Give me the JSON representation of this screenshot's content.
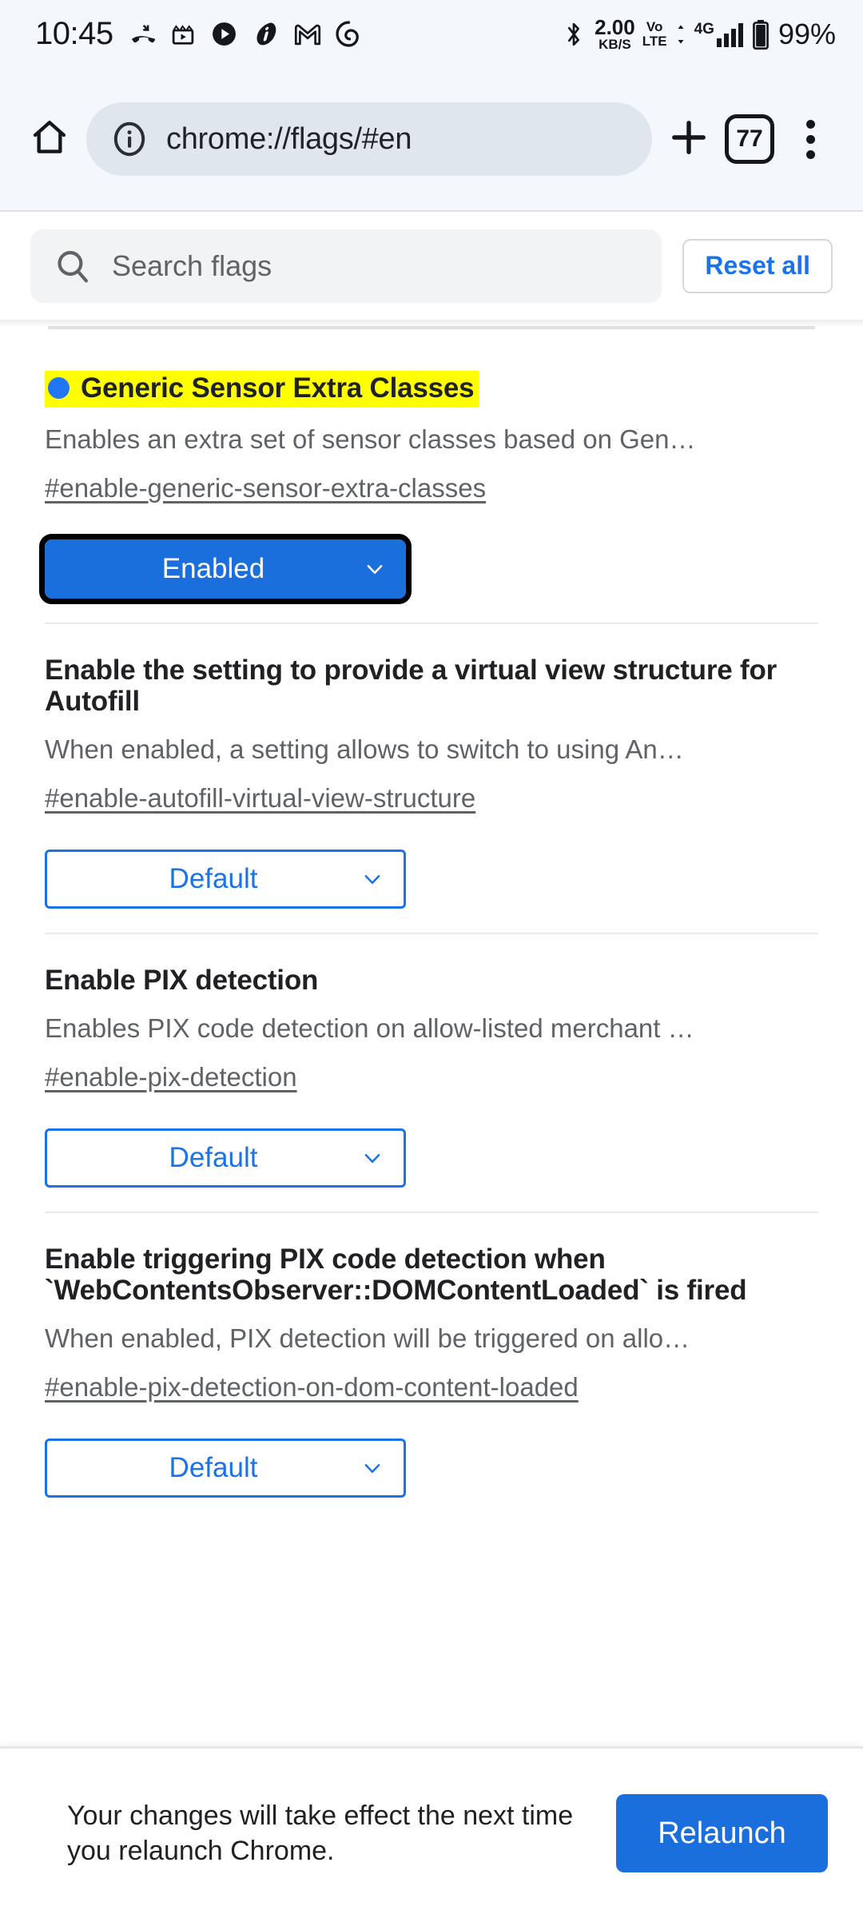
{
  "status_bar": {
    "time": "10:45",
    "left_icons": [
      "missed-call-icon",
      "clapperboard-icon",
      "play-circle-icon",
      "app-italic-i-icon",
      "gmail-icon",
      "spiral-app-icon"
    ],
    "bluetooth_icon": "bluetooth-icon",
    "network_speed_value": "2.00",
    "network_speed_unit": "KB/S",
    "volte_line1": "Vo",
    "volte_line2": "LTE",
    "network_type": "4G",
    "network_type_sup": "+",
    "battery": "99%"
  },
  "toolbar": {
    "home_icon": "home-icon",
    "page_info_icon": "info-circle-icon",
    "url": "chrome://flags/#en",
    "new_tab_icon": "plus-icon",
    "tab_count": "77",
    "menu_icon": "overflow-menu-icon"
  },
  "search": {
    "icon": "search-icon",
    "placeholder": "Search flags",
    "reset_label": "Reset all"
  },
  "flags": [
    {
      "title": "Generic Sensor Extra Classes",
      "highlighted": true,
      "marker": "blue-dot",
      "description": "Enables an extra set of sensor classes based on Gen…",
      "id": "#enable-generic-sensor-extra-classes",
      "select_value": "Enabled",
      "select_state": "enabled-focused"
    },
    {
      "title": "Enable the setting to provide a virtual view structure for Autofill",
      "highlighted": false,
      "description": "When enabled, a setting allows to switch to using An…",
      "id": "#enable-autofill-virtual-view-structure",
      "select_value": "Default",
      "select_state": "default"
    },
    {
      "title": "Enable PIX detection",
      "highlighted": false,
      "description": "Enables PIX code detection on allow-listed merchant …",
      "id": "#enable-pix-detection",
      "select_value": "Default",
      "select_state": "default"
    },
    {
      "title": "Enable triggering PIX code detection when `WebContentsObserver::DOMContentLoaded` is fired",
      "highlighted": false,
      "description": "When enabled, PIX detection will be triggered on allo…",
      "id": "#enable-pix-detection-on-dom-content-loaded",
      "select_value": "Default",
      "select_state": "default"
    }
  ],
  "bottom_bar": {
    "message": "Your changes will take effect the next time you relaunch Chrome.",
    "relaunch_label": "Relaunch"
  },
  "colors": {
    "accent_blue": "#1a73e8",
    "enabled_blue": "#1a6fdc",
    "highlight_yellow": "#ffff00",
    "marker_blue": "#2176f3",
    "toolbar_bg": "#f4f7fb",
    "omnibox_bg": "#dfe6ee"
  }
}
